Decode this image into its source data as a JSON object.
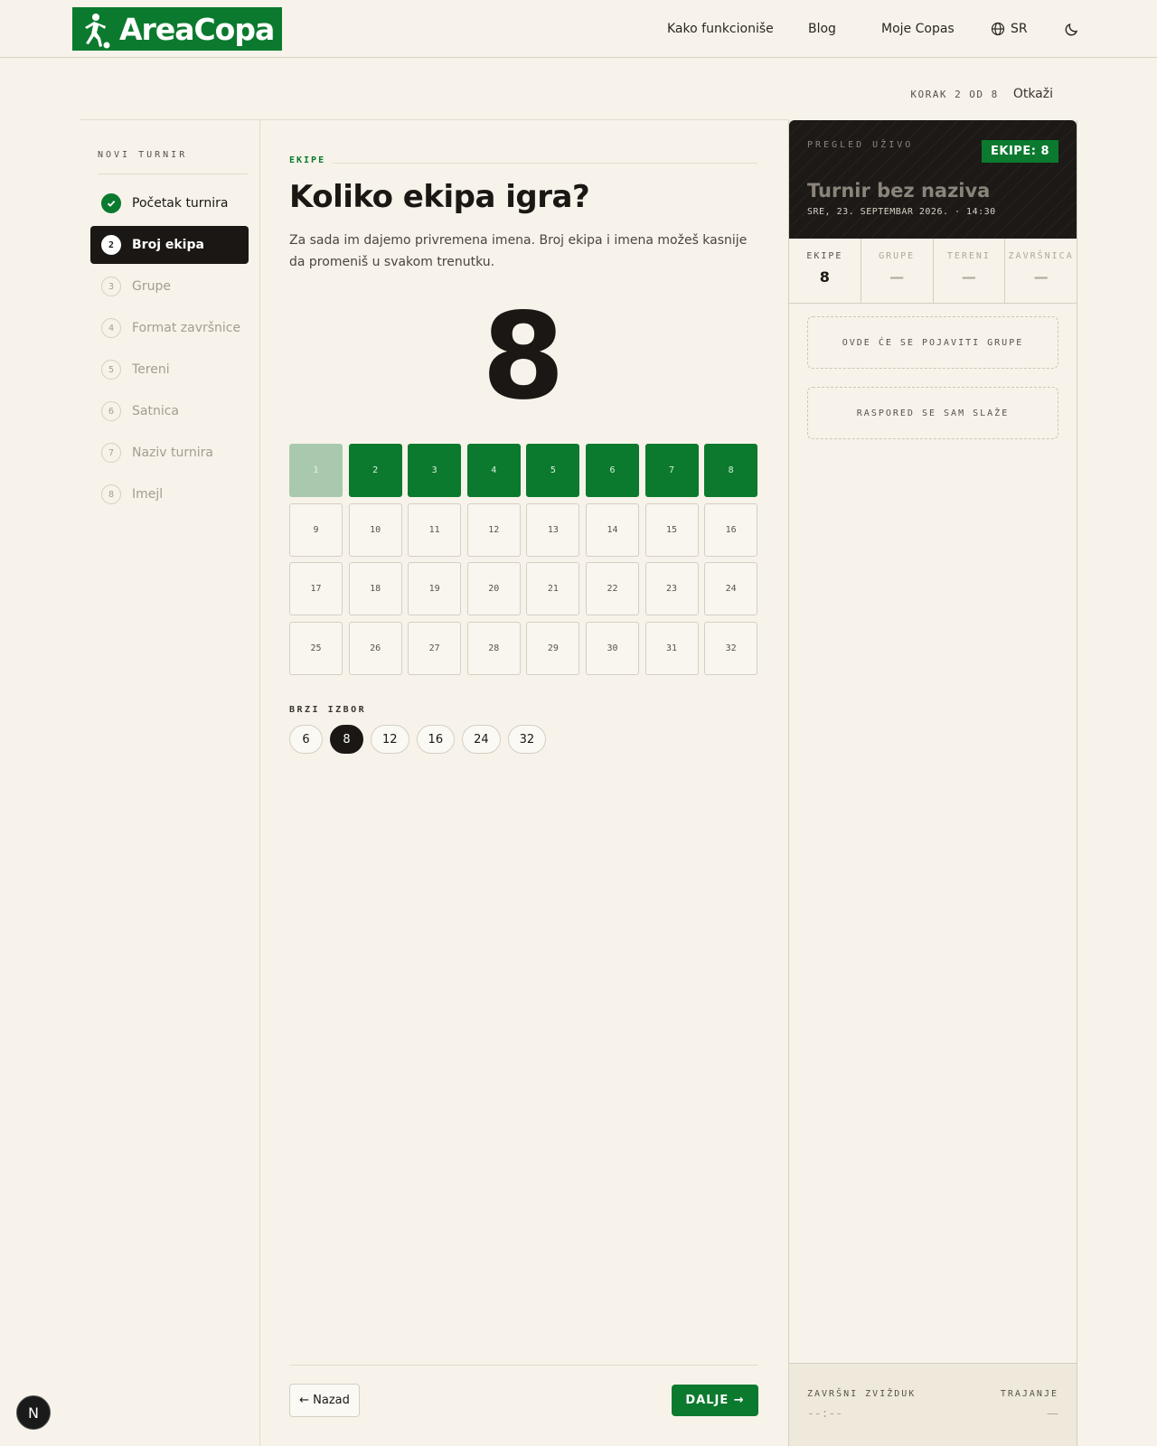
{
  "header": {
    "brand": "AreaCopa",
    "nav": [
      "Kako funkcioniše",
      "Blog",
      "Moje Copas"
    ],
    "language": "SR",
    "icons": [
      "globe-icon",
      "moon-icon"
    ]
  },
  "stepper": {
    "step_text": "KORAK 2 OD 8",
    "cancel_label": "Otkaži"
  },
  "sidebar": {
    "title": "NOVI TURNIR",
    "items": [
      {
        "num": "1",
        "label": "Početak turnira",
        "state": "done"
      },
      {
        "num": "2",
        "label": "Broj ekipa",
        "state": "active"
      },
      {
        "num": "3",
        "label": "Grupe",
        "state": "pending"
      },
      {
        "num": "4",
        "label": "Format završnice",
        "state": "pending"
      },
      {
        "num": "5",
        "label": "Tereni",
        "state": "pending"
      },
      {
        "num": "6",
        "label": "Satnica",
        "state": "pending"
      },
      {
        "num": "7",
        "label": "Naziv turnira",
        "state": "pending"
      },
      {
        "num": "8",
        "label": "Imejl",
        "state": "pending"
      }
    ]
  },
  "main": {
    "eyebrow": "EKIPE",
    "title": "Koliko ekipa igra?",
    "lead": "Za sada im dajemo privremena imena. Broj ekipa i imena možeš kasnije da promeniš u svakom trenutku.",
    "selected_count": "8",
    "grid_max": 32,
    "selected_value": 8,
    "quick_label": "BRZI IZBOR",
    "quick_options": [
      "6",
      "8",
      "12",
      "16",
      "24",
      "32"
    ],
    "back_label": "← Nazad",
    "next_label": "DALJE →"
  },
  "preview": {
    "eyebrow": "PREGLED UŽIVO",
    "badge": "EKIPE: 8",
    "title": "Turnir bez naziva",
    "date": "SRE, 23. SEPTEMBAR 2026. · 14:30",
    "stats": [
      {
        "label": "EKIPE",
        "value": "8",
        "active": true
      },
      {
        "label": "GRUPE",
        "value": "—",
        "active": false
      },
      {
        "label": "TERENI",
        "value": "—",
        "active": false
      },
      {
        "label": "ZAVRŠNICA",
        "value": "—",
        "active": false
      }
    ],
    "groups_placeholder": "OVDE ĆE SE POJAVITI GRUPE",
    "schedule_placeholder": "RASPORED SE SAM SLAŽE",
    "final_whistle_label": "ZAVRŠNI ZVIŽDUK",
    "final_whistle_value": "--:--",
    "duration_label": "TRAJANJE",
    "duration_value": "—"
  },
  "colors": {
    "accent": "#0b7a2e",
    "dark": "#1a1714",
    "background": "#f7f3ea"
  }
}
